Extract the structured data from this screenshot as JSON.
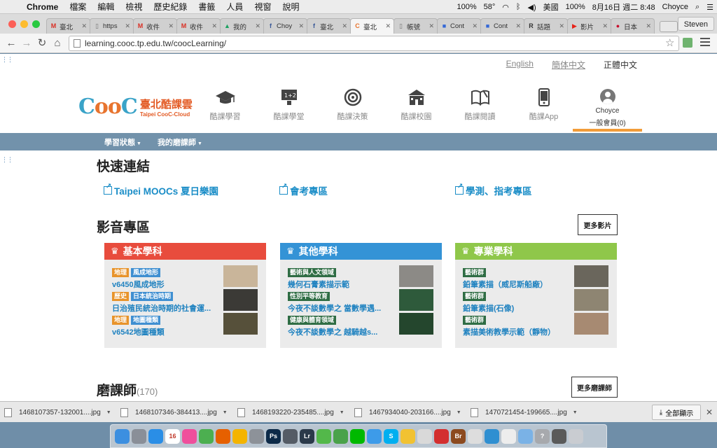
{
  "menubar": {
    "app": "Chrome",
    "items": [
      "檔案",
      "編輯",
      "檢視",
      "歷史紀錄",
      "書籤",
      "人員",
      "視窗",
      "說明"
    ],
    "status": {
      "zoom": "100%",
      "temp": "58°",
      "region": "美國",
      "battery": "100%",
      "datetime": "8月16日 週二 8:48",
      "user": "Choyce"
    }
  },
  "browser": {
    "tabs": [
      {
        "icon": "gmail-icon",
        "title": "臺北",
        "fav": "M",
        "color": "#d93025"
      },
      {
        "icon": "page-icon",
        "title": "https",
        "fav": "▯",
        "color": "#777"
      },
      {
        "icon": "gmail-icon",
        "title": "收件",
        "fav": "M",
        "color": "#d93025"
      },
      {
        "icon": "gmail-icon",
        "title": "收件",
        "fav": "M",
        "color": "#d93025"
      },
      {
        "icon": "drive-icon",
        "title": "我的",
        "fav": "▲",
        "color": "#1aa260"
      },
      {
        "icon": "facebook-icon",
        "title": "Choy",
        "fav": "f",
        "color": "#3b5998"
      },
      {
        "icon": "facebook-icon",
        "title": "臺北",
        "fav": "f",
        "color": "#3b5998"
      },
      {
        "icon": "cooc-icon",
        "title": "臺北",
        "fav": "C",
        "color": "#e8742e",
        "active": true
      },
      {
        "icon": "page-icon",
        "title": "帳號",
        "fav": "▯",
        "color": "#777"
      },
      {
        "icon": "page-icon",
        "title": "Cont",
        "fav": "■",
        "color": "#3367d6"
      },
      {
        "icon": "page-icon",
        "title": "Cont",
        "fav": "■",
        "color": "#3367d6"
      },
      {
        "icon": "r-icon",
        "title": "話題",
        "fav": "R",
        "color": "#333"
      },
      {
        "icon": "youtube-icon",
        "title": "影片",
        "fav": "▶",
        "color": "#e62117"
      },
      {
        "icon": "jal-icon",
        "title": "日本",
        "fav": "●",
        "color": "#c8102e"
      }
    ],
    "profile": "Steven",
    "url": "learning.cooc.tp.edu.tw/coocLearning/"
  },
  "site": {
    "languages": {
      "en": "English",
      "sc": "簡体中文",
      "tc": "正體中文"
    },
    "logo": {
      "cooc": "CooC",
      "cn": "臺北酷課雲",
      "en": "Taipei CooC-Cloud"
    },
    "nav": [
      {
        "label": "酷課學習",
        "icon": "graduation-cap-icon"
      },
      {
        "label": "酷課學堂",
        "icon": "blackboard-icon"
      },
      {
        "label": "酷課決策",
        "icon": "target-icon"
      },
      {
        "label": "酷課校園",
        "icon": "school-icon"
      },
      {
        "label": "酷課閱讀",
        "icon": "book-icon"
      },
      {
        "label": "酷課App",
        "icon": "phone-icon"
      }
    ],
    "user": {
      "name": "Choyce",
      "level": "一般會員(0)"
    },
    "subnav": [
      "學習狀態",
      "我的磨課師"
    ],
    "quick_links": {
      "title": "快速連結",
      "items": [
        "Taipei MOOCs 夏日樂園",
        "會考專區",
        "學測、指考專區"
      ]
    },
    "media": {
      "title": "影音專區",
      "more": "更多影片",
      "cards": [
        {
          "title": "基本學科",
          "color": "#e84c3d",
          "rows": [
            {
              "tags": [
                {
                  "text": "地理",
                  "tone": "orange"
                },
                {
                  "text": "風成地形",
                  "tone": "blue"
                }
              ],
              "title": "v6450風成地形",
              "thumb": "#c9b59a"
            },
            {
              "tags": [
                {
                  "text": "歷史",
                  "tone": "orange"
                },
                {
                  "text": "日本統治時期",
                  "tone": "blue"
                }
              ],
              "title": "日治殖民統治時期的社會運...",
              "thumb": "#3b3a36"
            },
            {
              "tags": [
                {
                  "text": "地理",
                  "tone": "orange"
                },
                {
                  "text": "地圖種類",
                  "tone": "blue"
                }
              ],
              "title": "v6542地圖種類",
              "thumb": "#56503a"
            }
          ]
        },
        {
          "title": "其他學科",
          "color": "#3493d6",
          "rows": [
            {
              "tags": [
                {
                  "text": "藝術與人文領域",
                  "tone": "green"
                }
              ],
              "title": "幾何石膏素描示範",
              "thumb": "#8c8a86"
            },
            {
              "tags": [
                {
                  "text": "性別平等教育",
                  "tone": "green"
                }
              ],
              "title": "今夜不談數學之 當數學遇...",
              "thumb": "#2e5a3b"
            },
            {
              "tags": [
                {
                  "text": "健康與體育領域",
                  "tone": "green"
                }
              ],
              "title": "今夜不談數學之 越騎越s...",
              "thumb": "#24462d"
            }
          ]
        },
        {
          "title": "專業學科",
          "color": "#8fc74a",
          "rows": [
            {
              "tags": [
                {
                  "text": "藝術群",
                  "tone": "green"
                }
              ],
              "title": "鉛筆素描（威尼斯船廠）",
              "thumb": "#6a665c"
            },
            {
              "tags": [
                {
                  "text": "藝術群",
                  "tone": "green"
                }
              ],
              "title": "鉛筆素描(石像)",
              "thumb": "#8e8572"
            },
            {
              "tags": [
                {
                  "text": "藝術群",
                  "tone": "green"
                }
              ],
              "title": "素描美術教學示範（靜物）",
              "thumb": "#a78a72"
            }
          ]
        }
      ]
    },
    "mooc": {
      "title": "磨課師",
      "count": "(170)",
      "more": "更多磨課師"
    }
  },
  "downloads": {
    "files": [
      "1468107357-132001....jpg",
      "1468107346-384413....jpg",
      "1468193220-235485....jpg",
      "1467934040-203166....jpg",
      "1470721454-199665....jpg"
    ],
    "show_all": "全部顯示"
  },
  "dock": {
    "apps": [
      {
        "icon": "finder-icon",
        "color": "#3c8fe0"
      },
      {
        "icon": "launchpad-icon",
        "color": "#8a8f98"
      },
      {
        "icon": "app-store-icon",
        "color": "#2a8ee6"
      },
      {
        "icon": "calendar-icon",
        "color": "#ffffff",
        "text": "16"
      },
      {
        "icon": "itunes-icon",
        "color": "#ef4f9c"
      },
      {
        "icon": "chrome-icon",
        "color": "#4caf50"
      },
      {
        "icon": "firefox-icon",
        "color": "#e66000"
      },
      {
        "icon": "photos-icon",
        "color": "#f4b400"
      },
      {
        "icon": "system-preferences-icon",
        "color": "#8d9299"
      },
      {
        "icon": "photoshop-icon",
        "color": "#0c2a48",
        "text": "Ps"
      },
      {
        "icon": "image-capture-icon",
        "color": "#555c66"
      },
      {
        "icon": "lightroom-icon",
        "color": "#2b3a4a",
        "text": "Lr"
      },
      {
        "icon": "vectorize-icon",
        "color": "#53b84a"
      },
      {
        "icon": "evernote-icon",
        "color": "#4aa24a"
      },
      {
        "icon": "line-icon",
        "color": "#00b900"
      },
      {
        "icon": "safari-icon",
        "color": "#3d9be9"
      },
      {
        "icon": "skype-icon",
        "color": "#00aff0",
        "text": "S"
      },
      {
        "icon": "wifi-app-icon",
        "color": "#f1c232"
      },
      {
        "icon": "preview-icon",
        "color": "#d9d9d9"
      },
      {
        "icon": "acrobat-icon",
        "color": "#d32f2f"
      },
      {
        "icon": "bridge-icon",
        "color": "#8c4a1f",
        "text": "Br"
      },
      {
        "icon": "textedit-icon",
        "color": "#dddddd"
      },
      {
        "icon": "paint-icon",
        "color": "#2f8fd1"
      },
      {
        "icon": "document-icon",
        "color": "#ededed"
      },
      {
        "icon": "folder-icon",
        "color": "#7ab2e6"
      },
      {
        "icon": "help-icon",
        "color": "#a7a9ad",
        "text": "?"
      },
      {
        "icon": "presentation-icon",
        "color": "#5a5a5a"
      },
      {
        "icon": "trash-icon",
        "color": "#c9ccd1"
      }
    ]
  }
}
